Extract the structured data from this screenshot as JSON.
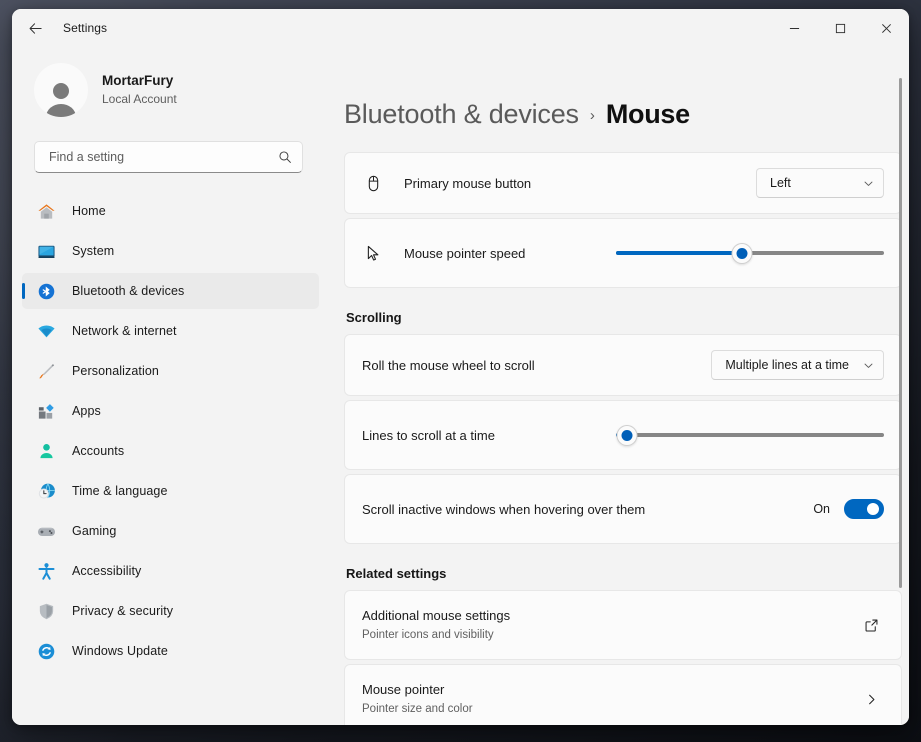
{
  "window": {
    "app_title": "Settings",
    "back_icon": "back-arrow-icon",
    "controls": {
      "minimize": "minimize-icon",
      "maximize": "maximize-icon",
      "close": "close-icon"
    }
  },
  "accent_color": "#0067c0",
  "sidebar": {
    "account": {
      "name": "MortarFury",
      "subtitle": "Local Account",
      "avatar_icon": "person-avatar-icon"
    },
    "search": {
      "placeholder": "Find a setting",
      "value": "",
      "icon": "search-icon"
    },
    "items": [
      {
        "label": "Home",
        "icon": "home-icon",
        "selected": false
      },
      {
        "label": "System",
        "icon": "system-monitor-icon",
        "selected": false
      },
      {
        "label": "Bluetooth & devices",
        "icon": "bluetooth-icon",
        "selected": true
      },
      {
        "label": "Network & internet",
        "icon": "wifi-icon",
        "selected": false
      },
      {
        "label": "Personalization",
        "icon": "paintbrush-icon",
        "selected": false
      },
      {
        "label": "Apps",
        "icon": "apps-grid-icon",
        "selected": false
      },
      {
        "label": "Accounts",
        "icon": "accounts-person-icon",
        "selected": false
      },
      {
        "label": "Time & language",
        "icon": "clock-globe-icon",
        "selected": false
      },
      {
        "label": "Gaming",
        "icon": "gamepad-icon",
        "selected": false
      },
      {
        "label": "Accessibility",
        "icon": "accessibility-person-icon",
        "selected": false
      },
      {
        "label": "Privacy & security",
        "icon": "shield-icon",
        "selected": false
      },
      {
        "label": "Windows Update",
        "icon": "update-refresh-icon",
        "selected": false
      }
    ]
  },
  "main": {
    "breadcrumb": {
      "parent": "Bluetooth & devices",
      "separator": "›",
      "current": "Mouse"
    },
    "primary_button_row": {
      "label": "Primary mouse button",
      "icon": "mouse-icon",
      "dropdown_value": "Left",
      "dropdown_icon": "chevron-down-icon"
    },
    "pointer_speed_row": {
      "label": "Mouse pointer speed",
      "icon": "cursor-arrow-icon",
      "slider_percent": 47
    },
    "scrolling_section": {
      "heading": "Scrolling",
      "wheel_row": {
        "label": "Roll the mouse wheel to scroll",
        "dropdown_value": "Multiple lines at a time",
        "dropdown_icon": "chevron-down-icon"
      },
      "lines_row": {
        "label": "Lines to scroll at a time",
        "slider_percent": 4
      },
      "inactive_row": {
        "label": "Scroll inactive windows when hovering over them",
        "state_label": "On",
        "toggle_on": true
      }
    },
    "related_section": {
      "heading": "Related settings",
      "items": [
        {
          "title": "Additional mouse settings",
          "subtitle": "Pointer icons and visibility",
          "trailing_icon": "external-link-icon"
        },
        {
          "title": "Mouse pointer",
          "subtitle": "Pointer size and color",
          "trailing_icon": "chevron-right-icon"
        }
      ]
    },
    "scrollbar": {
      "icon": "vertical-scrollbar"
    }
  }
}
